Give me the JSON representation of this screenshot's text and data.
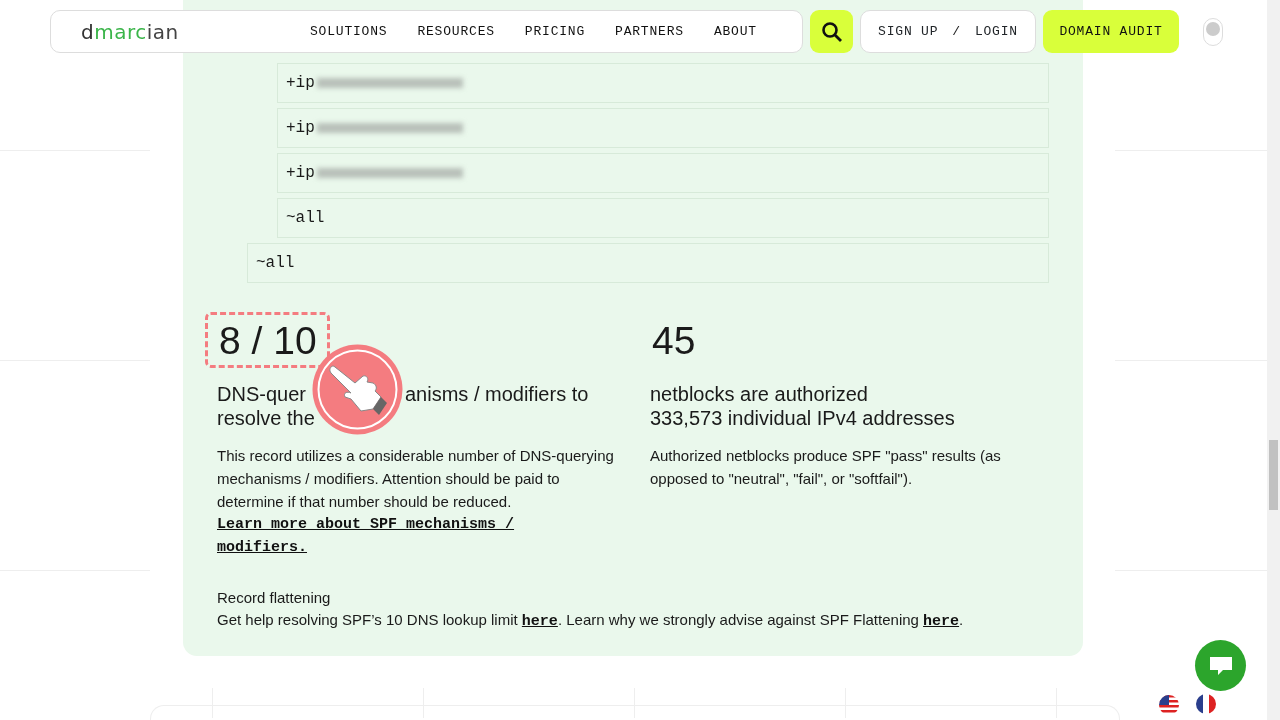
{
  "navbar": {
    "logo": [
      {
        "text": "d",
        "color": "#333333"
      },
      {
        "text": "marc",
        "color": "#3bb54a"
      },
      {
        "text": "ian",
        "color": "#444444"
      }
    ],
    "links": [
      "SOLUTIONS",
      "RESOURCES",
      "PRICING",
      "PARTNERS",
      "ABOUT"
    ],
    "auth": {
      "sign_up": "SIGN UP",
      "separator": "/",
      "login": "LOGIN"
    },
    "cta": "DOMAIN AUDIT",
    "theme_toggle": {
      "on": false
    }
  },
  "spf_tree": [
    {
      "children": [
        {
          "text": "+ip",
          "redacted": true
        },
        {
          "text": "+ip",
          "redacted": true
        },
        {
          "text": "+ip",
          "redacted": true
        },
        {
          "text": "~all",
          "redacted": false
        }
      ]
    },
    {
      "text": "~all",
      "redacted": false
    }
  ],
  "stats": [
    {
      "value": "8 / 10",
      "highlighted": true,
      "heading_lines": [
        [
          "DNS-quer",
          "anisms / modifiers to"
        ],
        [
          "resolve the"
        ]
      ],
      "body": "This record utilizes a considerable number of DNS-querying mechanisms / modifiers. Attention should be paid to determine if that number should be reduced.",
      "link": "Learn more about SPF mechanisms / modifiers."
    },
    {
      "value": "45",
      "highlighted": false,
      "heading_lines": [
        [
          "netblocks are authorized"
        ],
        [
          "333,573 individual IPv4 addresses"
        ]
      ],
      "body": "Authorized netblocks produce SPF \"pass\" results (as opposed to \"neutral\", \"fail\", or \"softfail\")."
    }
  ],
  "flattening": {
    "title": "Record flattening",
    "parts": [
      {
        "kind": "text",
        "text": "Get help resolving SPF’s 10 DNS lookup limit "
      },
      {
        "kind": "link",
        "text": "here"
      },
      {
        "kind": "text",
        "text": ". Learn why we strongly advise against SPF Flattening "
      },
      {
        "kind": "link",
        "text": "here"
      },
      {
        "kind": "text",
        "text": "."
      }
    ]
  }
}
